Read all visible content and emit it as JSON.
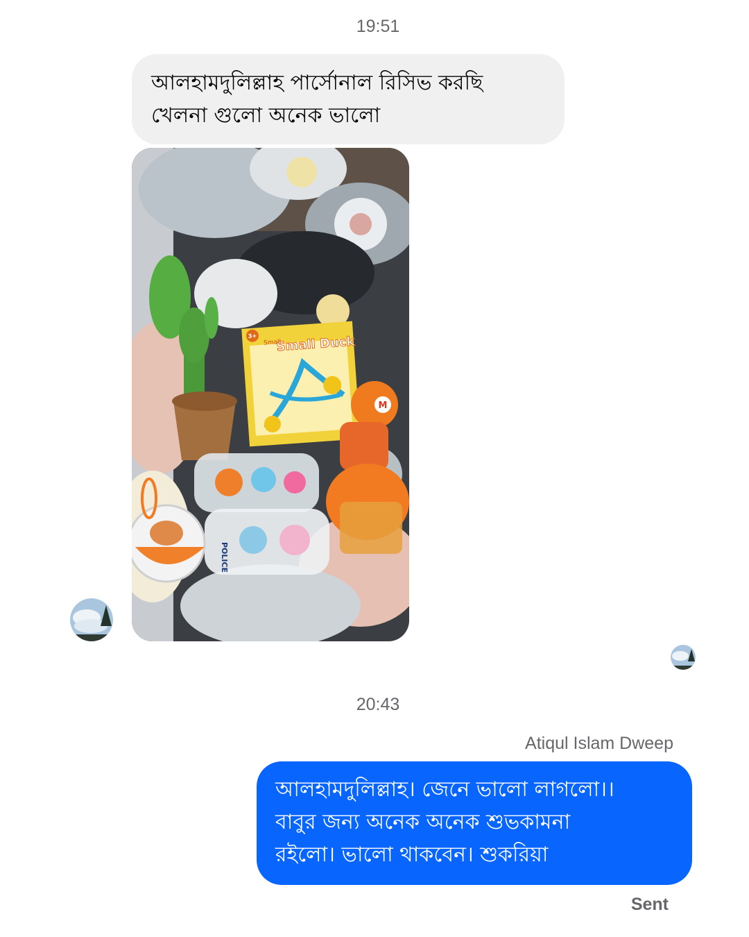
{
  "conversation": {
    "timestamps": [
      "19:51",
      "20:43"
    ],
    "incoming": {
      "text_lines": [
        "আলহামদুলিল্লাহ পার্সোনাল রিসিভ করছি",
        "খেলনা গুলো অনেক ভালো"
      ],
      "photo_box_label": "Small Duck",
      "photo_box_sublabel": "Small",
      "photo_box_age": "3+",
      "photo_car_label": "POLICE",
      "photo_cap_letter": "M"
    },
    "outgoing": {
      "sender_name": "Atiqul Islam Dweep",
      "text_lines": [
        "আলহামদুলিল্লাহ।  জেনে ভালো লাগলো।।",
        "বাবুর জন্য অনেক অনেক শুভকামনা",
        "রইলো।  ভালো থাকবেন।  শুকরিয়া"
      ],
      "status": "Sent"
    }
  },
  "colors": {
    "incoming_bubble": "#f0f0f0",
    "outgoing_bubble": "#0866ff",
    "meta_text": "#65676b"
  },
  "icons": {
    "contact_avatar": "contact-avatar-sky-tree",
    "seen_indicator": "seen-avatar-icon"
  }
}
